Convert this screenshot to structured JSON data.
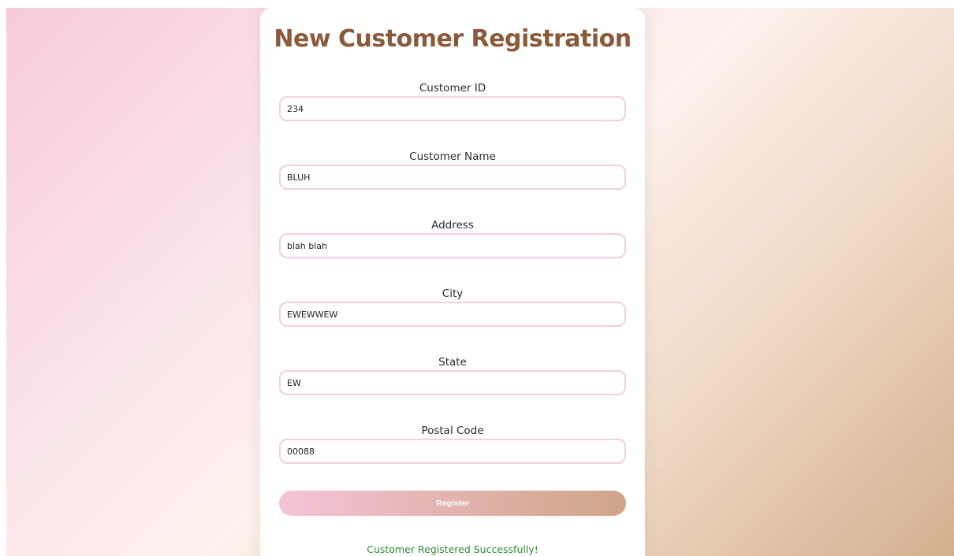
{
  "form": {
    "title": "New Customer Registration",
    "fields": [
      {
        "label": "Customer ID",
        "value": "234"
      },
      {
        "label": "Customer Name",
        "value": "BLUH"
      },
      {
        "label": "Address",
        "value": "blah blah"
      },
      {
        "label": "City",
        "value": "EWEWWEW"
      },
      {
        "label": "State",
        "value": "EW"
      },
      {
        "label": "Postal Code",
        "value": "00088"
      }
    ],
    "register_label": "Register",
    "status_message": "Customer Registered Successfully!"
  },
  "colors": {
    "title": "#8b5a3a",
    "input_border": "#f3cfe0",
    "success": "#2e8b2e",
    "button_gradient_start": "#f5c3d8",
    "button_gradient_end": "#cfa587"
  }
}
